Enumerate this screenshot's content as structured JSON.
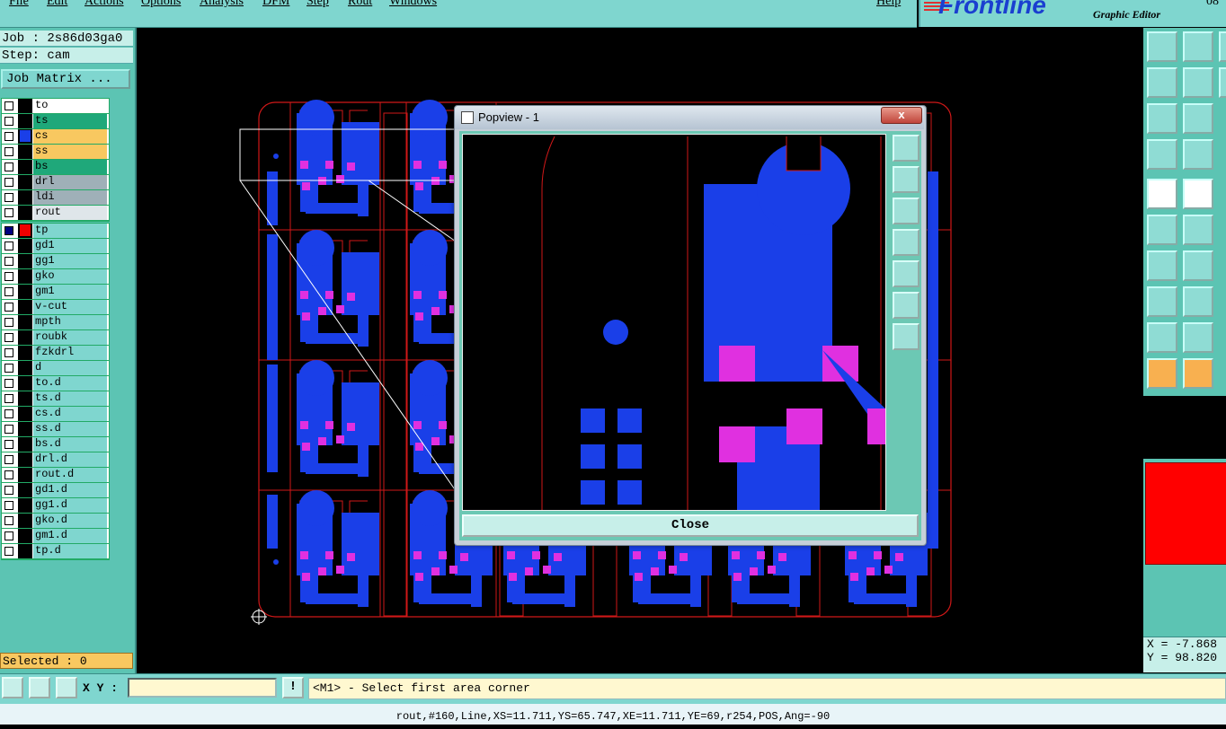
{
  "menu": {
    "items": [
      "File",
      "Edit",
      "Actions",
      "Options",
      "Analysis",
      "DFM",
      "Step",
      "Rout",
      "Windows"
    ],
    "help": "Help"
  },
  "brand": {
    "name": "Frontline",
    "subtitle": "Graphic Editor",
    "version": "08"
  },
  "job": {
    "job_line": "Job : 2s86d03ga0",
    "step_line": "Step: cam",
    "matrix_button": "Job Matrix ..."
  },
  "layers": {
    "board": [
      {
        "name": "to",
        "color": "#ffffff"
      },
      {
        "name": "ts",
        "color": "#1fa87a"
      },
      {
        "name": "cs",
        "color": "#f8c860",
        "swatch": "#1a3fe8"
      },
      {
        "name": "ss",
        "color": "#f8c860"
      },
      {
        "name": "bs",
        "color": "#1fa87a"
      }
    ],
    "drill": [
      {
        "name": "drl",
        "color": "#9fb0b8"
      },
      {
        "name": "ldi",
        "color": "#9fb0b8"
      },
      {
        "name": "rout",
        "color": "#dfe6ea"
      }
    ],
    "misc": [
      {
        "name": "tp",
        "color": "#7fd6cf",
        "swatch": "#f00000",
        "check_color": "#000080"
      },
      {
        "name": "gd1",
        "color": "#7fd6cf"
      },
      {
        "name": "gg1",
        "color": "#7fd6cf"
      },
      {
        "name": "gko",
        "color": "#7fd6cf"
      },
      {
        "name": "gm1",
        "color": "#7fd6cf"
      },
      {
        "name": "v-cut",
        "color": "#7fd6cf"
      },
      {
        "name": "mpth",
        "color": "#7fd6cf"
      },
      {
        "name": "roubk",
        "color": "#7fd6cf"
      },
      {
        "name": "fzkdrl",
        "color": "#7fd6cf"
      },
      {
        "name": "d",
        "color": "#7fd6cf"
      },
      {
        "name": "to.d",
        "color": "#7fd6cf"
      },
      {
        "name": "ts.d",
        "color": "#7fd6cf"
      },
      {
        "name": "cs.d",
        "color": "#7fd6cf"
      },
      {
        "name": "ss.d",
        "color": "#7fd6cf"
      },
      {
        "name": "bs.d",
        "color": "#7fd6cf"
      },
      {
        "name": "drl.d",
        "color": "#7fd6cf"
      },
      {
        "name": "rout.d",
        "color": "#7fd6cf"
      },
      {
        "name": "gd1.d",
        "color": "#7fd6cf"
      },
      {
        "name": "gg1.d",
        "color": "#7fd6cf"
      },
      {
        "name": "gko.d",
        "color": "#7fd6cf"
      },
      {
        "name": "gm1.d",
        "color": "#7fd6cf"
      },
      {
        "name": "tp.d",
        "color": "#7fd6cf"
      }
    ]
  },
  "selected": "Selected : 0",
  "popview": {
    "title": "Popview - 1",
    "close_x": "x",
    "close_button": "Close"
  },
  "coords": {
    "x": "X = -7.868",
    "y": "Y = 98.820"
  },
  "bottom": {
    "xy_label": "X Y :",
    "xy_value": "",
    "info_icon": "!",
    "message": "<M1> - Select first area corner"
  },
  "status": "rout,#160,Line,XS=11.711,YS=65.747,XE=11.711,YE=69,r254,POS,Ang=-90",
  "colors": {
    "copper": "#1a3fe8",
    "pad": "#e030e0",
    "outline": "#d01818",
    "panel": "#5cc4b3"
  }
}
